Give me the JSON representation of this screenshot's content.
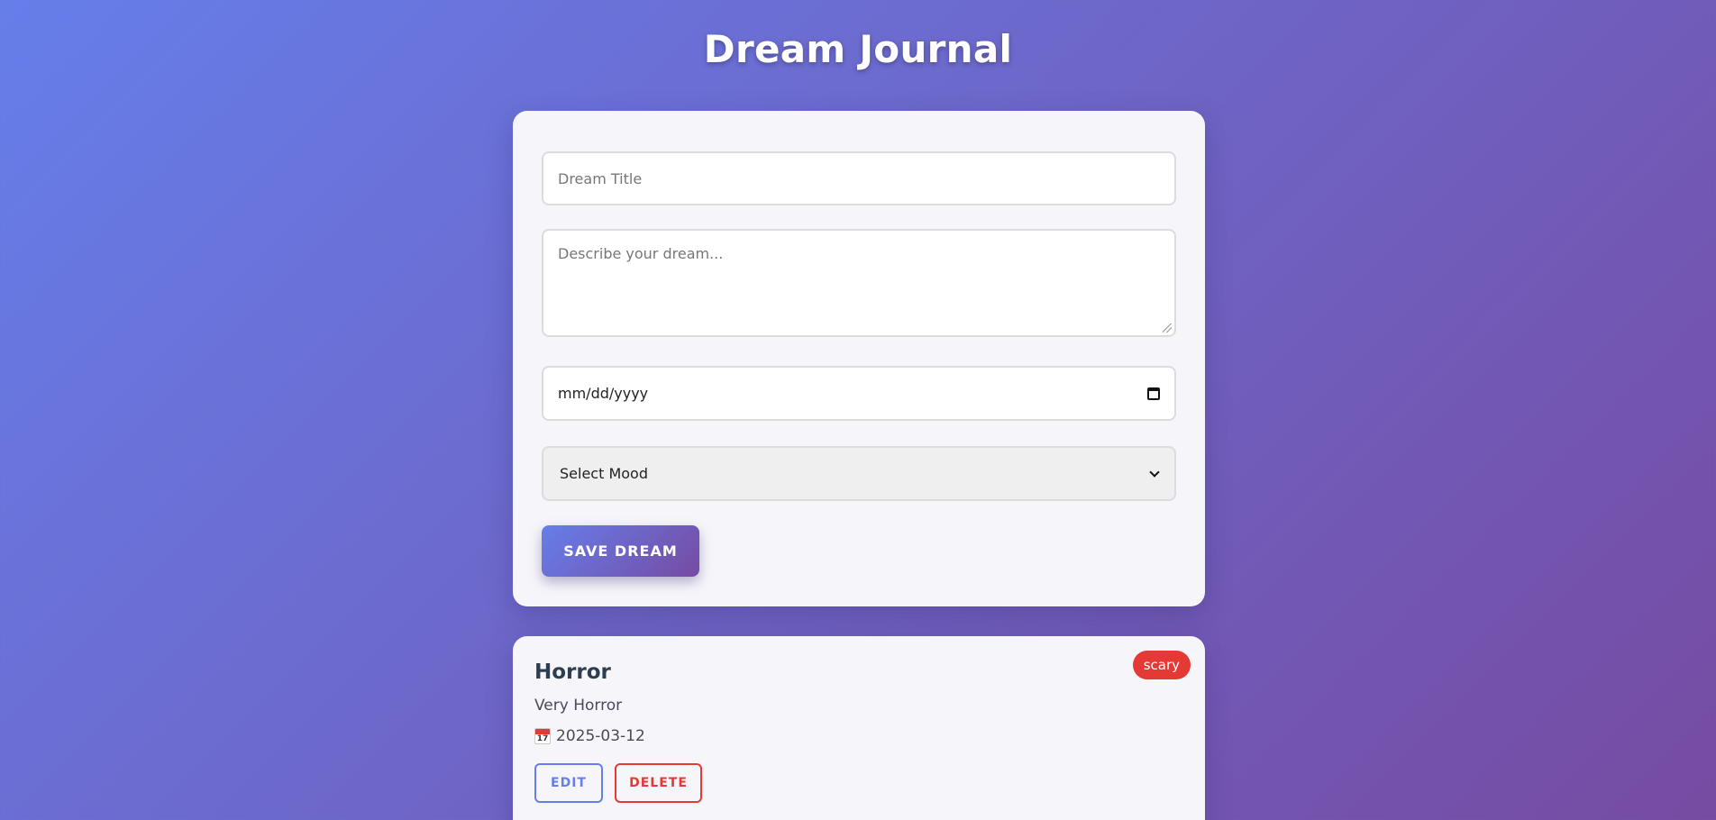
{
  "header": {
    "title": "Dream Journal"
  },
  "form": {
    "title_placeholder": "Dream Title",
    "description_placeholder": "Describe your dream...",
    "date_placeholder": "mm/dd/yyyy",
    "mood_selected": "Select Mood",
    "save_label": "SAVE DREAM"
  },
  "entries": [
    {
      "title": "Horror",
      "description": "Very Horror",
      "date": "2025-03-12",
      "mood": "scary",
      "mood_color": "#e53935",
      "edit_label": "EDIT",
      "delete_label": "DELETE"
    }
  ],
  "colors": {
    "gradient_start": "#667eea",
    "gradient_end": "#764ba2",
    "danger": "#e53935"
  }
}
